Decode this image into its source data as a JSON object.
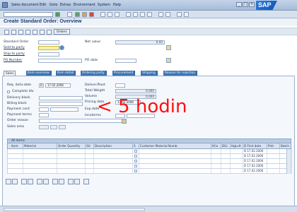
{
  "menubar": {
    "items": [
      "Sales document",
      "Edit",
      "Goto",
      "Extras",
      "Environment",
      "System",
      "Help"
    ],
    "logo": "SAP"
  },
  "title": "Create Standard Order: Overview",
  "toolbar": {
    "orders_label": "Orders"
  },
  "header": {
    "standard_order_label": "Standard Order",
    "net_value_label": "Net value",
    "net_value": "0.00",
    "sold_to_label": "Sold-to party",
    "ship_to_label": "Ship-to party",
    "po_number_label": "PO Number",
    "po_date_label": "PO date"
  },
  "tabs": [
    "Sales",
    "Item overview",
    "Item detail",
    "Ordering party",
    "Procurement",
    "Shipping",
    "Reason for rejection"
  ],
  "sales_tab": {
    "req_deliv_date_label": "Req. deliv.date",
    "req_deliv_unit": "D",
    "req_deliv_date": "17.02.2006",
    "complete_dlv_label": "Complete dlv.",
    "delivery_block_label": "Delivery block",
    "billing_block_label": "Billing block",
    "payment_card_label": "Payment card",
    "payment_terms_label": "Payment terms",
    "order_reason_label": "Order reason",
    "sales_area_label": "Sales area",
    "deliver_plant_label": "Deliver.Plant",
    "total_weight_label": "Total Weight",
    "total_weight": "0.000",
    "volume_label": "Volume",
    "volume": "0.000",
    "pricing_date_label": "Pricing date",
    "pricing_date": "17.02.2006",
    "exp_date_label": "Exp.date",
    "incoterms_label": "Incoterms"
  },
  "overlay": "< 5 hodin",
  "items_grid": {
    "title": "All items",
    "columns": [
      "Item",
      "Material",
      "Order Quantity",
      "SU",
      "Description",
      "S",
      "Customer Material Numb",
      "ItCa",
      "DGi",
      "HgLvIt",
      "D First date",
      "Plnt",
      "Batch"
    ],
    "rows": [
      {
        "first_date": "D 17.02.2006"
      },
      {
        "first_date": "D 17.02.2006"
      },
      {
        "first_date": "D 17.02.2006"
      },
      {
        "first_date": "D 17.02.2006"
      },
      {
        "first_date": "D 17.02.2006"
      }
    ]
  },
  "colors": {
    "tab_blue": "#3c74b4",
    "title_blue": "#1c3a74",
    "overlay_red": "#ff1010",
    "required_yellow": "#f7f0a6"
  }
}
